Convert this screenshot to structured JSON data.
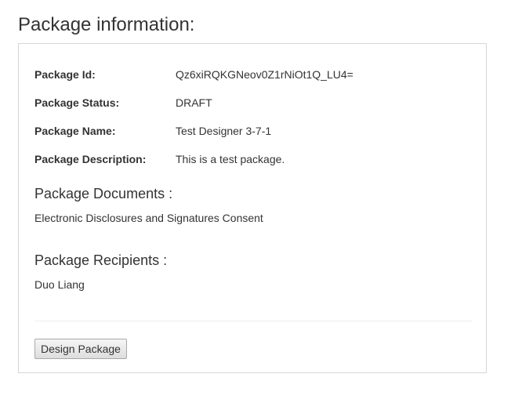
{
  "page": {
    "title": "Package information:"
  },
  "fields": [
    {
      "label": "Package Id:",
      "value": "Qz6xiRQKGNeov0Z1rNiOt1Q_LU4="
    },
    {
      "label": "Package Status:",
      "value": "DRAFT"
    },
    {
      "label": "Package Name:",
      "value": "Test Designer 3-7-1"
    },
    {
      "label": "Package Description:",
      "value": "This is a test package."
    }
  ],
  "documents": {
    "heading": "Package Documents :",
    "items": [
      "Electronic Disclosures and Signatures Consent"
    ]
  },
  "recipients": {
    "heading": "Package Recipients :",
    "items": [
      "Duo Liang"
    ]
  },
  "actions": {
    "design_label": "Design Package"
  }
}
